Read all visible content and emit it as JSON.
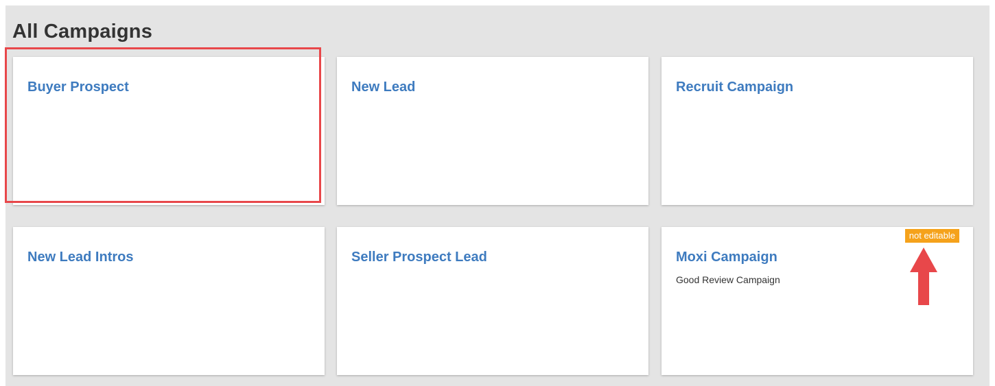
{
  "header": {
    "title": "All Campaigns"
  },
  "campaigns": [
    {
      "title": "Buyer Prospect",
      "subtitle": "",
      "badge": ""
    },
    {
      "title": "New Lead",
      "subtitle": "",
      "badge": ""
    },
    {
      "title": "Recruit Campaign",
      "subtitle": "",
      "badge": ""
    },
    {
      "title": "New Lead Intros",
      "subtitle": "",
      "badge": ""
    },
    {
      "title": "Seller Prospect Lead",
      "subtitle": "",
      "badge": ""
    },
    {
      "title": "Moxi Campaign",
      "subtitle": "Good Review Campaign",
      "badge": "not editable"
    }
  ],
  "colors": {
    "panel_background": "#e4e4e4",
    "card_title": "#3e7bbf",
    "badge_background": "#f5a21b",
    "annotation_red": "#e8474a"
  },
  "annotations": {
    "highlighted_card": "Buyer Prospect",
    "arrow_points_to": "not editable",
    "arrow_icon": "arrow-up-icon"
  }
}
